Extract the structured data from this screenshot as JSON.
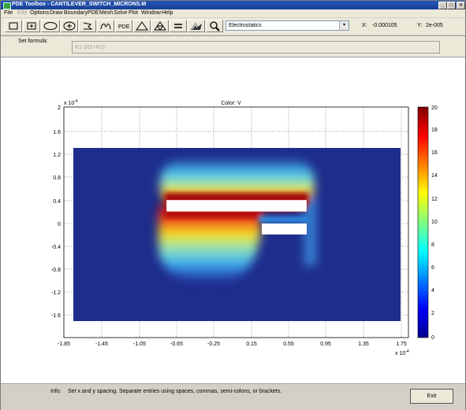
{
  "window": {
    "title": "PDE Toolbox - CANTILEVER_SWITCH_MICRONS.M",
    "controls": [
      "_",
      "□",
      "×"
    ]
  },
  "menubar": {
    "items": [
      "File",
      "Edit",
      "Options",
      "Draw",
      "Boundary",
      "PDE",
      "Mesh",
      "Solve",
      "Plot",
      "Window",
      "Help"
    ]
  },
  "toolbar": {
    "tools": [
      "rectangle-icon",
      "rectangle-center-icon",
      "ellipse-icon",
      "ellipse-center-icon",
      "polygon-icon",
      "boundary-mode-icon",
      "pde-icon",
      "mesh-triangle-icon",
      "refine-mesh-icon",
      "solve-icon",
      "plot-icon",
      "zoom-icon"
    ],
    "pde_label": "PDE",
    "solve_label": "=",
    "app_mode": "Electrostatics",
    "x_label": "X:",
    "x_value": "-0.000105",
    "y_label": "Y:",
    "y_value": "2e-005"
  },
  "formula": {
    "label": "Set formula:",
    "value": "R1-(R2+R3)"
  },
  "plot": {
    "title": "Color: V",
    "xaxis": {
      "ticks": [
        "-1.85",
        "-1.45",
        "-1.05",
        "-0.65",
        "-0.25",
        "0.15",
        "0.55",
        "0.95",
        "1.35",
        "1.75"
      ],
      "exponent_prefix": "x 10",
      "exponent": "-4"
    },
    "yaxis": {
      "ticks": [
        "2",
        "1.6",
        "1.2",
        "0.8",
        "0.4",
        "0",
        "-0.4",
        "-0.8",
        "-1.2",
        "-1.6"
      ],
      "exponent_prefix": "x 10",
      "exponent": "-4"
    },
    "colorbar": {
      "ticks": [
        "20",
        "18",
        "16",
        "14",
        "12",
        "10",
        "8",
        "6",
        "4",
        "2",
        "0"
      ],
      "range": [
        0,
        20
      ],
      "colormap": "jet"
    },
    "grid": "dotted",
    "colors": {
      "background_field": "#1e2d8c",
      "high": "#9a0d10",
      "mid": "#f4f21a",
      "low_mid": "#5dd0f0"
    }
  },
  "status": {
    "info_label": "Info:",
    "info_text": "Set x and y spacing. Separate entries using spaces, commas, semi-colons, or brackets.",
    "exit_label": "Exit"
  }
}
